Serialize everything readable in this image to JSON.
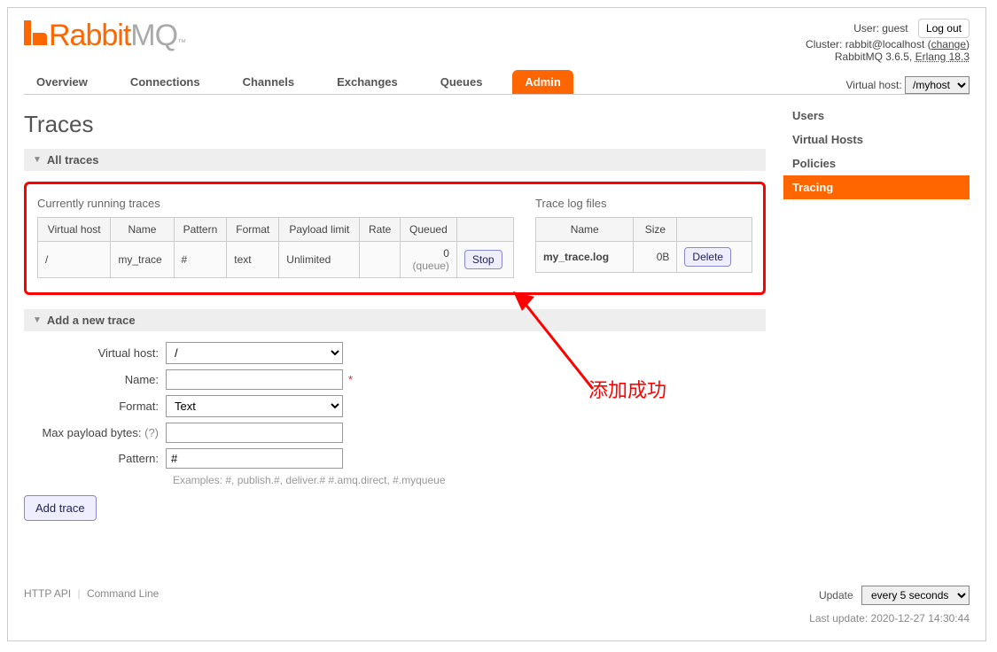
{
  "header": {
    "user_label": "User:",
    "user_name": "guest",
    "logout": "Log out",
    "cluster_label": "Cluster:",
    "cluster_name": "rabbit@localhost",
    "change": "change",
    "version": "RabbitMQ 3.6.5,",
    "erlang": "Erlang 18.3"
  },
  "nav": {
    "tabs": [
      "Overview",
      "Connections",
      "Channels",
      "Exchanges",
      "Queues",
      "Admin"
    ],
    "vhost_label": "Virtual host:",
    "vhost_value": "/myhost"
  },
  "page_title": "Traces",
  "sections": {
    "all_traces": "All traces",
    "add_new": "Add a new trace"
  },
  "running": {
    "heading": "Currently running traces",
    "cols": [
      "Virtual host",
      "Name",
      "Pattern",
      "Format",
      "Payload limit",
      "Rate",
      "Queued"
    ],
    "row": {
      "vhost": "/",
      "name": "my_trace",
      "pattern": "#",
      "format": "text",
      "limit": "Unlimited",
      "rate": "",
      "queued_count": "0",
      "queued_sub": "(queue)",
      "stop": "Stop"
    }
  },
  "logfiles": {
    "heading": "Trace log files",
    "cols": [
      "Name",
      "Size"
    ],
    "row": {
      "name": "my_trace.log",
      "size": "0B",
      "delete": "Delete"
    }
  },
  "form": {
    "vhost_label": "Virtual host:",
    "vhost_value": "/",
    "name_label": "Name:",
    "format_label": "Format:",
    "format_value": "Text",
    "maxpayload_label": "Max payload bytes:",
    "maxpayload_help": "(?)",
    "pattern_label": "Pattern:",
    "pattern_value": "#",
    "pattern_hint": "Examples: #, publish.#, deliver.# #.amq.direct, #.myqueue",
    "submit": "Add trace"
  },
  "sidebar": [
    "Users",
    "Virtual Hosts",
    "Policies",
    "Tracing"
  ],
  "footer": {
    "http_api": "HTTP API",
    "cmdline": "Command Line",
    "update_label": "Update",
    "update_value": "every 5 seconds",
    "last_update": "Last update: 2020-12-27 14:30:44"
  },
  "annotation": {
    "text": "添加成功"
  }
}
